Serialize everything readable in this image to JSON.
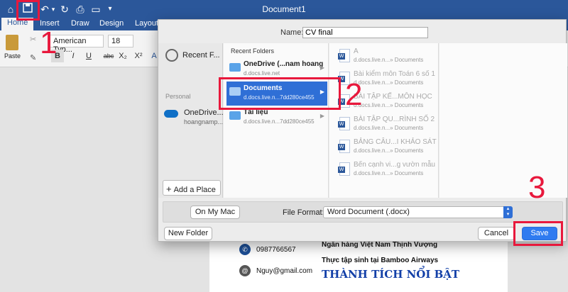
{
  "word": {
    "title": "Document1",
    "tabs": [
      "Home",
      "Insert",
      "Draw",
      "Design",
      "Layout"
    ],
    "font_name": "American Typ...",
    "font_size": "18",
    "paste_label": "Paste",
    "format_buttons": [
      "B",
      "I",
      "U",
      "abc",
      "X₂",
      "X²",
      "A"
    ]
  },
  "document": {
    "phone": "0987766567",
    "email": "Nguy@gmail.com",
    "line1": "Ngân hàng Việt Nam Thịnh Vượng",
    "line2": "Thực tập sinh tại Bamboo Airways",
    "heading": "THÀNH TÍCH NỔI BẬT"
  },
  "dialog": {
    "name_label": "Name:",
    "name_value": "CV final",
    "sidebar": {
      "recent": "Recent F...",
      "section": "Personal",
      "onedrive": "OneDrive...",
      "onedrive_sub": "hoangnamp...",
      "add_place": "Add a Place"
    },
    "recent_folders_label": "Recent Folders",
    "folders": [
      {
        "name": "OneDrive (...nam hoang",
        "sub": "d.docs.live.net"
      },
      {
        "name": "Documents",
        "sub": "d.docs.live.n...7dd280ce455"
      },
      {
        "name": "Tài liệu",
        "sub": "d.docs.live.n...7dd280ce455"
      }
    ],
    "files": [
      {
        "name": "A",
        "loc": "d.docs.live.n...» Documents"
      },
      {
        "name": "Bài kiểm môn Toán 6 số 1",
        "loc": "d.docs.live.n...» Documents"
      },
      {
        "name": "BÀI TẬP KẾ...MÔN HỌC",
        "loc": "d.docs.live.n...» Documents"
      },
      {
        "name": "BÀI TẬP QU...RÌNH SỐ 2",
        "loc": "d.docs.live.n...» Documents"
      },
      {
        "name": "BẢNG CÂU...I KHẢO SÁT",
        "loc": "d.docs.live.n...» Documents"
      },
      {
        "name": "Bến cạnh vi...g vườn mẫu",
        "loc": "d.docs.live.n...» Documents"
      }
    ],
    "on_my_mac": "On My Mac",
    "file_format_label": "File Format:",
    "file_format_value": "Word Document (.docx)",
    "new_folder": "New Folder",
    "cancel": "Cancel",
    "save": "Save"
  },
  "annotations": [
    "1",
    "2",
    "3"
  ],
  "colors": {
    "accent": "#2b579a",
    "highlight": "#e8183c",
    "selection": "#2f6fd6"
  }
}
